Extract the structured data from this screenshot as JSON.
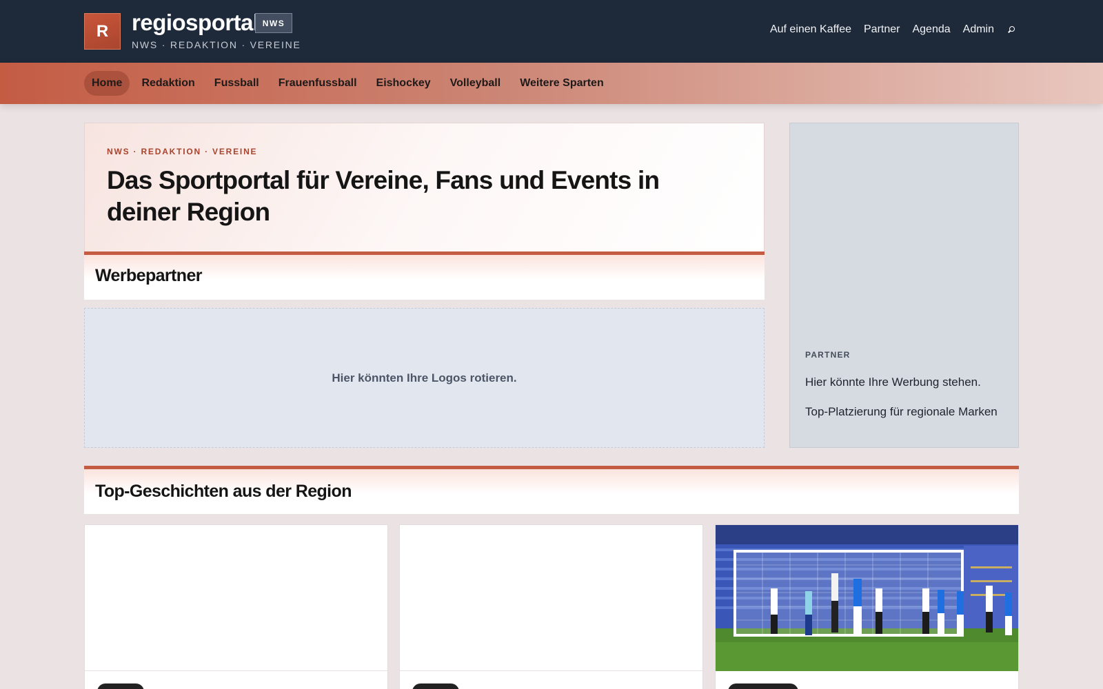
{
  "brand": {
    "logo_letter": "R",
    "name": "regiosportal",
    "badge": "NWS",
    "tagline": "NWS · REDAKTION · VEREINE"
  },
  "topnav": {
    "items": [
      "Auf einen Kaffee",
      "Partner",
      "Agenda",
      "Admin"
    ],
    "search_icon": "search-icon"
  },
  "catnav": {
    "active": "Home",
    "items": [
      "Home",
      "Redaktion",
      "Fussball",
      "Frauenfussball",
      "Eishockey",
      "Volleyball",
      "Weitere Sparten"
    ]
  },
  "hero": {
    "eyebrow": "NWS · REDAKTION · VEREINE",
    "title": "Das Sportportal für Vereine, Fans und Events in deiner Region"
  },
  "werbepartner": {
    "heading": "Werbepartner",
    "placeholder": "Hier könnten Ihre Logos rotieren."
  },
  "partner": {
    "label": "PARTNER",
    "line1": "Hier könnte Ihre Werbung stehen.",
    "line2": "Top-Platzierung für regionale Marken"
  },
  "top_stories": {
    "heading": "Top-Geschichten aus der Region",
    "cards": [
      {
        "tag": ""
      },
      {
        "tag": ""
      },
      {
        "tag": ""
      }
    ]
  },
  "colors": {
    "topbar": "#1e2939",
    "accent": "#c45c44",
    "page_bg": "#ebe3e3"
  }
}
